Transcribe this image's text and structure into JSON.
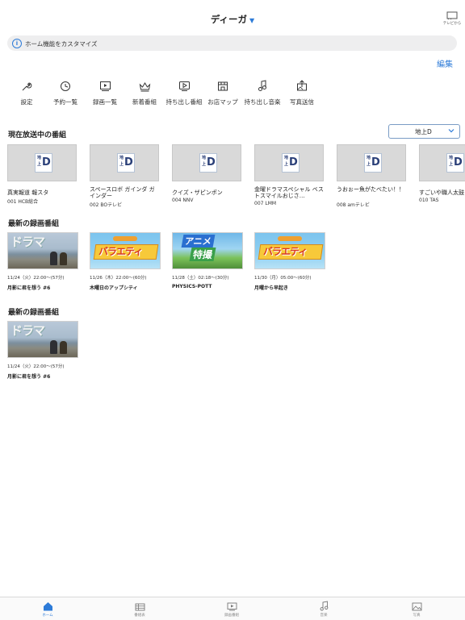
{
  "header": {
    "title": "ディーガ",
    "tv_label": "テレビから"
  },
  "customize_bar": {
    "text": "ホーム機能をカスタマイズ"
  },
  "edit_label": "編集",
  "quick_menu": [
    {
      "label": "設定",
      "icon": "wrench-icon"
    },
    {
      "label": "予約一覧",
      "icon": "clock-icon"
    },
    {
      "label": "録画一覧",
      "icon": "recordings-icon"
    },
    {
      "label": "新着番組",
      "icon": "crown-icon"
    },
    {
      "label": "持ち出し番組",
      "icon": "takeout-play-icon"
    },
    {
      "label": "お店マップ",
      "icon": "shop-icon"
    },
    {
      "label": "持ち出し音楽",
      "icon": "music-note-icon"
    },
    {
      "label": "写真送信",
      "icon": "photo-send-icon"
    }
  ],
  "now_on_air": {
    "title": "現在放送中の番組",
    "dropdown_value": "地上D",
    "logo": {
      "line1": "地",
      "line2": "上",
      "letter": "D"
    },
    "channels": [
      {
        "name": "真実報道 報スタ",
        "number": "001 HCB総合"
      },
      {
        "name": "スペースロボ ガインダ ガインダー",
        "number": "002 BOテレビ"
      },
      {
        "name": "クイズ・ザピンポン",
        "number": "004 NNV"
      },
      {
        "name": "金曜ドラマスペシャル ベストスマイルおじさ…",
        "number": "007 LMM"
      },
      {
        "name": "うおぉー魚がたべたい！！",
        "number": "008 amテレビ"
      },
      {
        "name": "すごいや職人太鼓",
        "number": "010 TAS"
      }
    ]
  },
  "latest_recordings_1": {
    "title": "最新の録画番組",
    "items": [
      {
        "thumb": "drama",
        "thumb_text": "ドラマ",
        "time": "11/24（火）22:00〜(57分)",
        "program": "月影に君を想う #6"
      },
      {
        "thumb": "variety",
        "thumb_text": "バラエティ",
        "time": "11/26（木）22:00〜(60分)",
        "program": "木曜日のアップシティ"
      },
      {
        "thumb": "anime",
        "thumb_text": "アニメ",
        "thumb_text2": "特撮",
        "time": "11/28（土）02:18〜(30分)",
        "program": "PHYSICS-POTT"
      },
      {
        "thumb": "variety",
        "thumb_text": "バラエティ",
        "time": "11/30（月）05:00〜(60分)",
        "program": "月曜から早起き"
      }
    ]
  },
  "latest_recordings_2": {
    "title": "最新の録画番組",
    "items": [
      {
        "thumb": "drama",
        "thumb_text": "ドラマ",
        "time": "11/24（火）22:00〜(57分)",
        "program": "月影に君を想う #6"
      }
    ]
  },
  "tabbar": [
    {
      "label": "ホーム",
      "icon": "home-icon",
      "active": true
    },
    {
      "label": "番組表",
      "icon": "program-guide-icon",
      "active": false
    },
    {
      "label": "録画番組",
      "icon": "recorded-programs-icon",
      "active": false
    },
    {
      "label": "音楽",
      "icon": "music-icon",
      "active": false
    },
    {
      "label": "写真",
      "icon": "photo-icon",
      "active": false
    }
  ],
  "colors": {
    "accent": "#2d7bd8",
    "bar_bg": "#eeeeef"
  }
}
